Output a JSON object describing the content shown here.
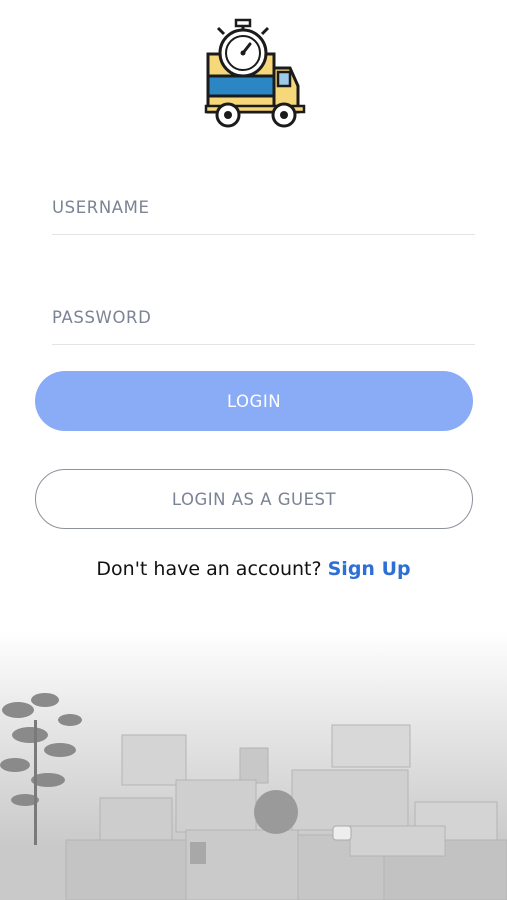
{
  "login_form": {
    "username_placeholder": "USERNAME",
    "password_placeholder": "PASSWORD",
    "login_label": "LOGIN",
    "guest_label": "LOGIN AS A GUEST"
  },
  "signup": {
    "prompt": "Don't have an account? ",
    "link": "Sign Up"
  },
  "colors": {
    "primary_button": "#8aacf7",
    "link": "#2d6fd6",
    "placeholder": "#7b8394"
  },
  "icons": {
    "logo": "delivery-truck-stopwatch-icon",
    "background": "moving-boxes-photo"
  }
}
